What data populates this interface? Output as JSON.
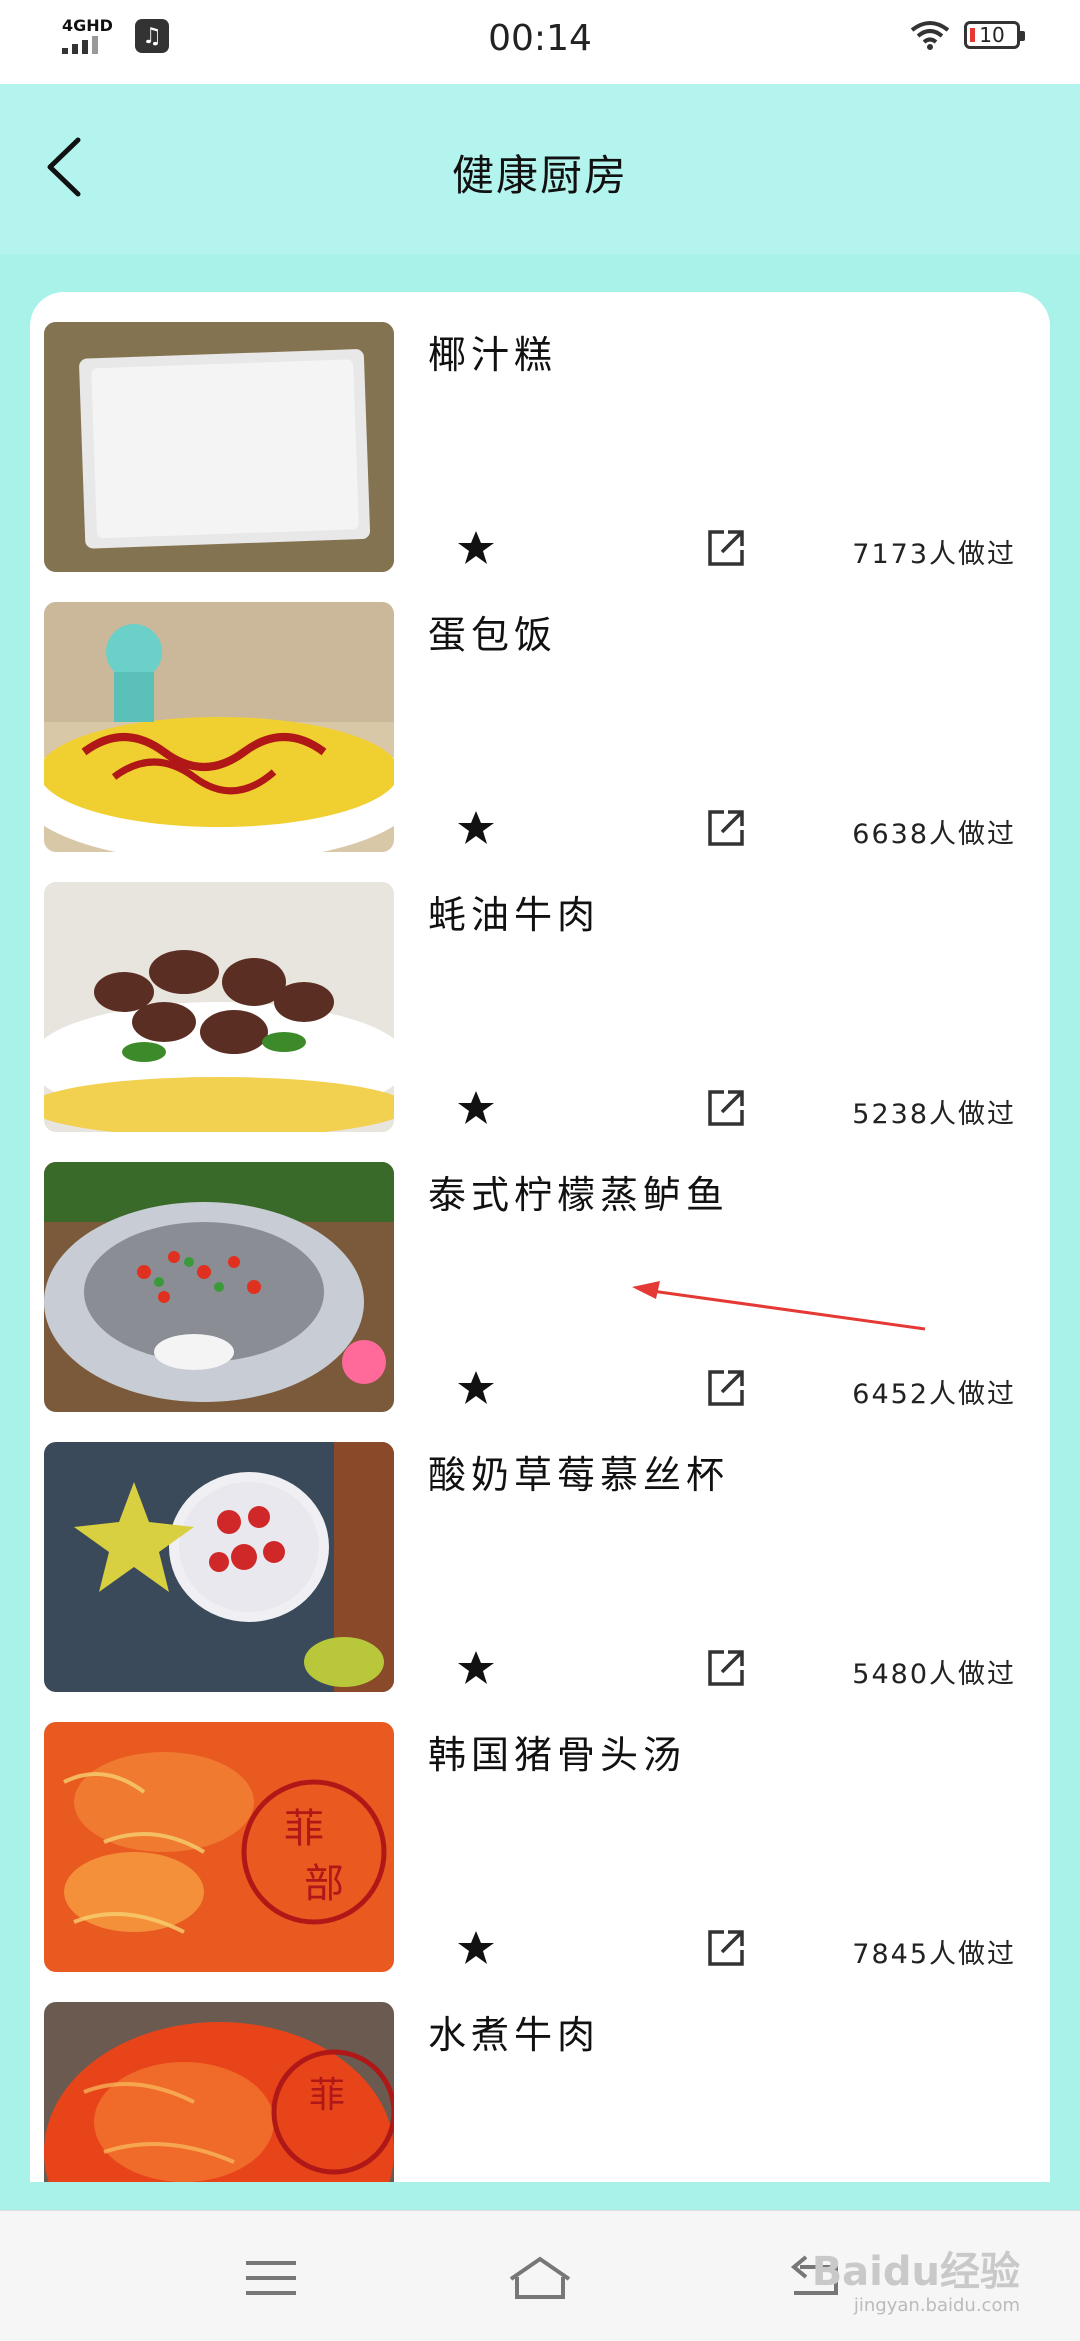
{
  "status_bar": {
    "network": "4GHD",
    "time": "00:14",
    "battery": "10",
    "icons": [
      "signal-icon",
      "music-app-icon",
      "wifi-icon",
      "battery-icon"
    ]
  },
  "header": {
    "title": "健康厨房",
    "back_icon": "chevron-left-icon"
  },
  "recipes": [
    {
      "name": "椰汁糕",
      "count": "7173人做过"
    },
    {
      "name": "蛋包饭",
      "count": "6638人做过"
    },
    {
      "name": "蚝油牛肉",
      "count": "5238人做过"
    },
    {
      "name": "泰式柠檬蒸鲈鱼",
      "count": "6452人做过"
    },
    {
      "name": "酸奶草莓慕丝杯",
      "count": "5480人做过"
    },
    {
      "name": "韩国猪骨头汤",
      "count": "7845人做过"
    },
    {
      "name": "水煮牛肉",
      "count": ""
    }
  ],
  "nav_bar": {
    "icons": [
      "menu-icon",
      "home-icon",
      "back-nav-icon"
    ],
    "watermark": "Baidu经验",
    "watermark_sub": "jingyan.baidu.com"
  },
  "colors": {
    "header_bg": "#b4f4ee",
    "content_bg": "#a8f2ea",
    "card_bg": "#ffffff",
    "annotation_arrow": "#e53935"
  }
}
